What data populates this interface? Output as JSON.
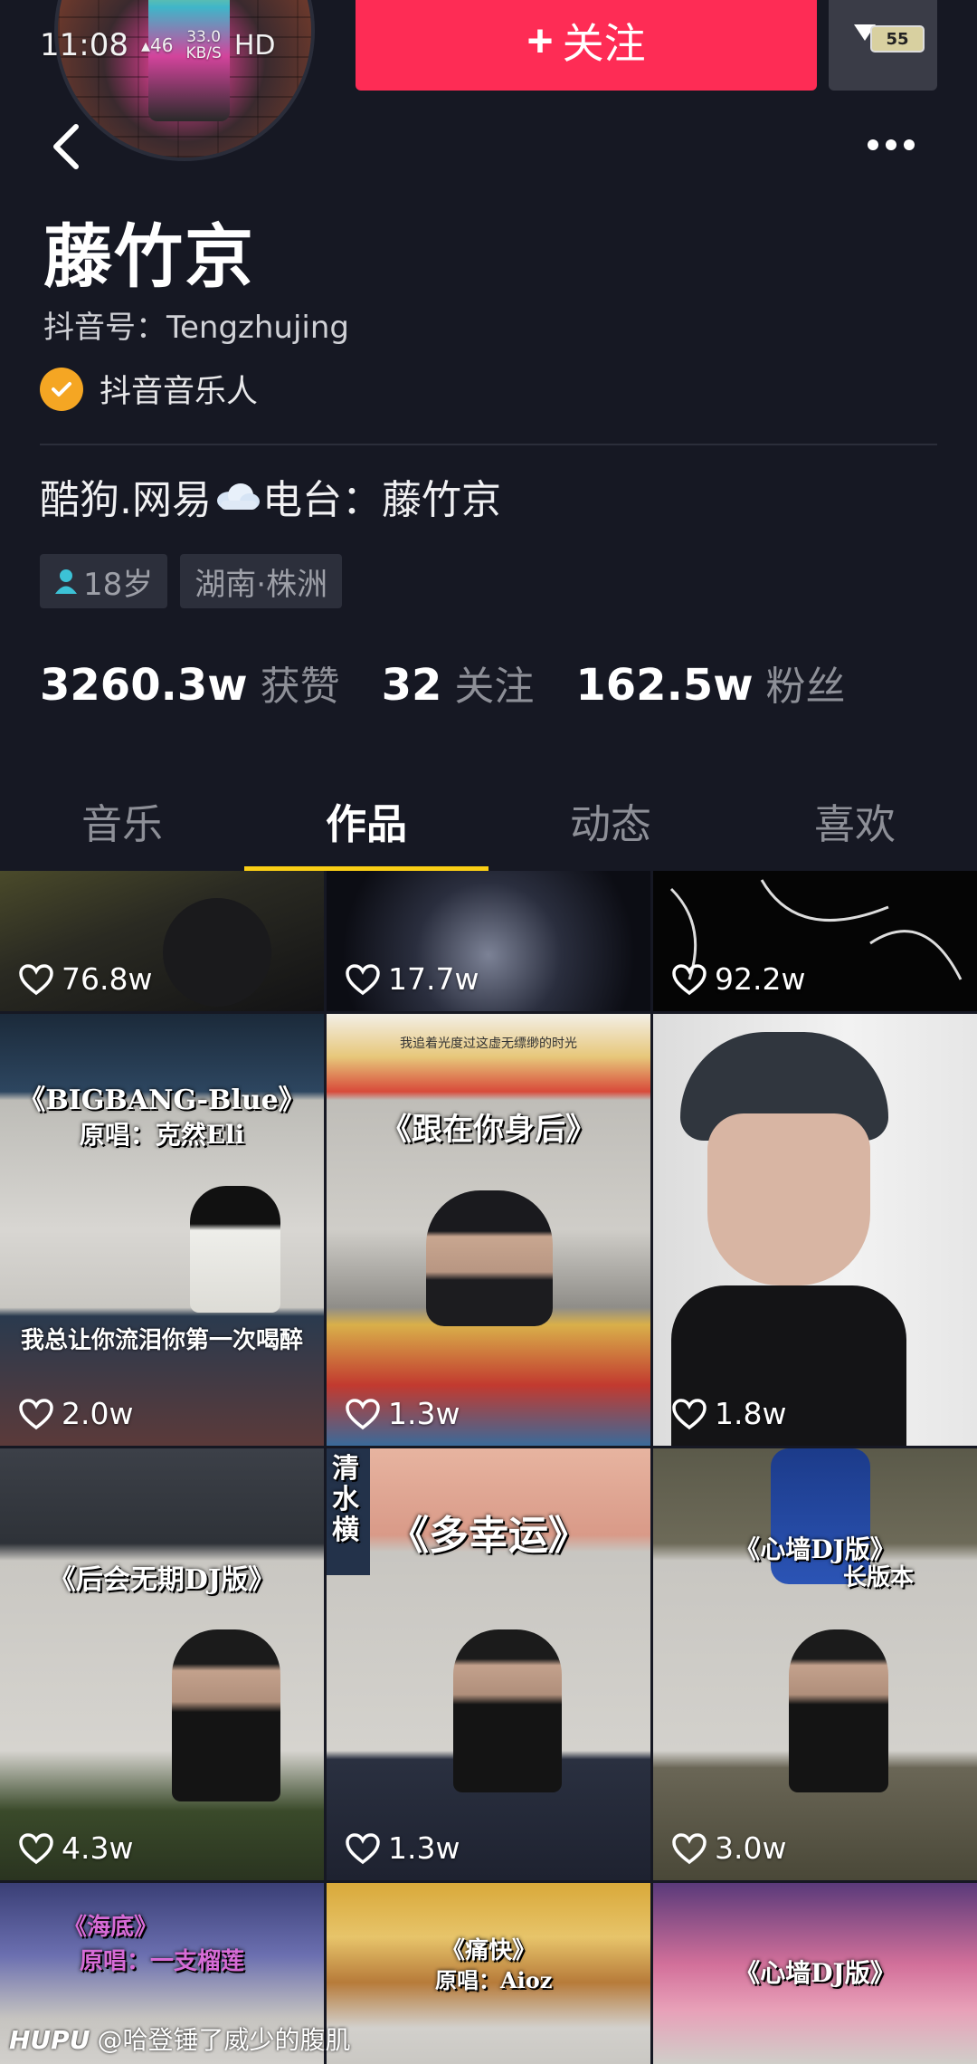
{
  "status": {
    "time": "11:08",
    "network": "46",
    "speed": "33.0\nKB/S",
    "hd": "HD",
    "battery": "55"
  },
  "profile": {
    "name": "藤竹京",
    "douyin_id": "抖音号：Tengzhujing",
    "verify_label": "抖音音乐人",
    "bio_prefix": "酷狗.网易",
    "bio_suffix": "电台：藤竹京",
    "tags": [
      "18岁",
      "湖南·株洲"
    ]
  },
  "actions": {
    "follow_label": "关注"
  },
  "stats": [
    {
      "value": "3260.3w",
      "label": "获赞"
    },
    {
      "value": "32",
      "label": "关注"
    },
    {
      "value": "162.5w",
      "label": "粉丝"
    }
  ],
  "tabs": [
    {
      "label": "音乐",
      "active": false
    },
    {
      "label": "作品",
      "active": true
    },
    {
      "label": "动态",
      "active": false
    },
    {
      "label": "喜欢",
      "active": false
    }
  ],
  "videos": [
    {
      "likes": "76.8w",
      "captions": []
    },
    {
      "likes": "17.7w",
      "captions": []
    },
    {
      "likes": "92.2w",
      "captions": []
    },
    {
      "likes": "2.0w",
      "captions": [
        "《BIGBANG-Blue》",
        "原唱：克然Eli",
        "我总让你流泪你第一次喝醉"
      ]
    },
    {
      "likes": "1.3w",
      "captions": [
        "《跟在你身后》",
        "我追着光度过这虚无缥缈的时光"
      ]
    },
    {
      "likes": "1.8w",
      "captions": []
    },
    {
      "likes": "4.3w",
      "captions": [
        "《后会无期DJ版》"
      ]
    },
    {
      "likes": "1.3w",
      "captions": [
        "《多幸运》",
        "清水横"
      ]
    },
    {
      "likes": "3.0w",
      "captions": [
        "《心墙DJ版》",
        "长版本"
      ]
    },
    {
      "likes": "",
      "captions": [
        "《海底》",
        "原唱：一支榴莲"
      ]
    },
    {
      "likes": "",
      "captions": [
        "《痛快》",
        "原唱：Aioz"
      ]
    },
    {
      "likes": "",
      "captions": [
        "《心墙DJ版》"
      ]
    }
  ],
  "watermark": {
    "brand": "HUPU",
    "text": "@哈登锤了威少的腹肌"
  },
  "colors": {
    "background": "#161823",
    "follow": "#fe2c55",
    "tab_indicator": "#face15",
    "verify": "#f5a623"
  }
}
